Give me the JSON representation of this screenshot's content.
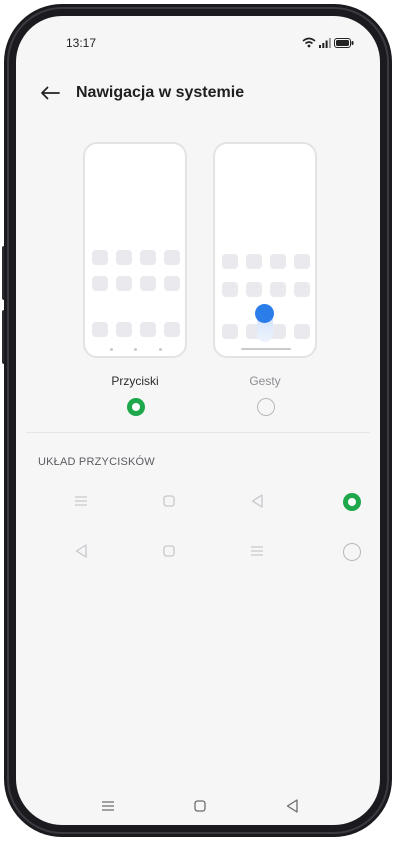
{
  "status": {
    "time": "13:17"
  },
  "header": {
    "title": "Nawigacja w systemie"
  },
  "modes": [
    {
      "label": "Przyciski",
      "selected": true
    },
    {
      "label": "Gesty",
      "selected": false
    }
  ],
  "layout_section": {
    "title": "UKŁAD PRZYCISKÓW",
    "options": [
      {
        "icons": [
          "menu-icon",
          "square-icon",
          "triangle-back-icon"
        ],
        "selected": true
      },
      {
        "icons": [
          "triangle-back-icon",
          "square-icon",
          "menu-icon"
        ],
        "selected": false
      }
    ]
  },
  "nav_bar": {
    "icons": [
      "menu-icon",
      "square-icon",
      "triangle-back-icon"
    ]
  },
  "colors": {
    "accent_green": "#1ea84b",
    "gesture_blue": "#2b7de9"
  }
}
